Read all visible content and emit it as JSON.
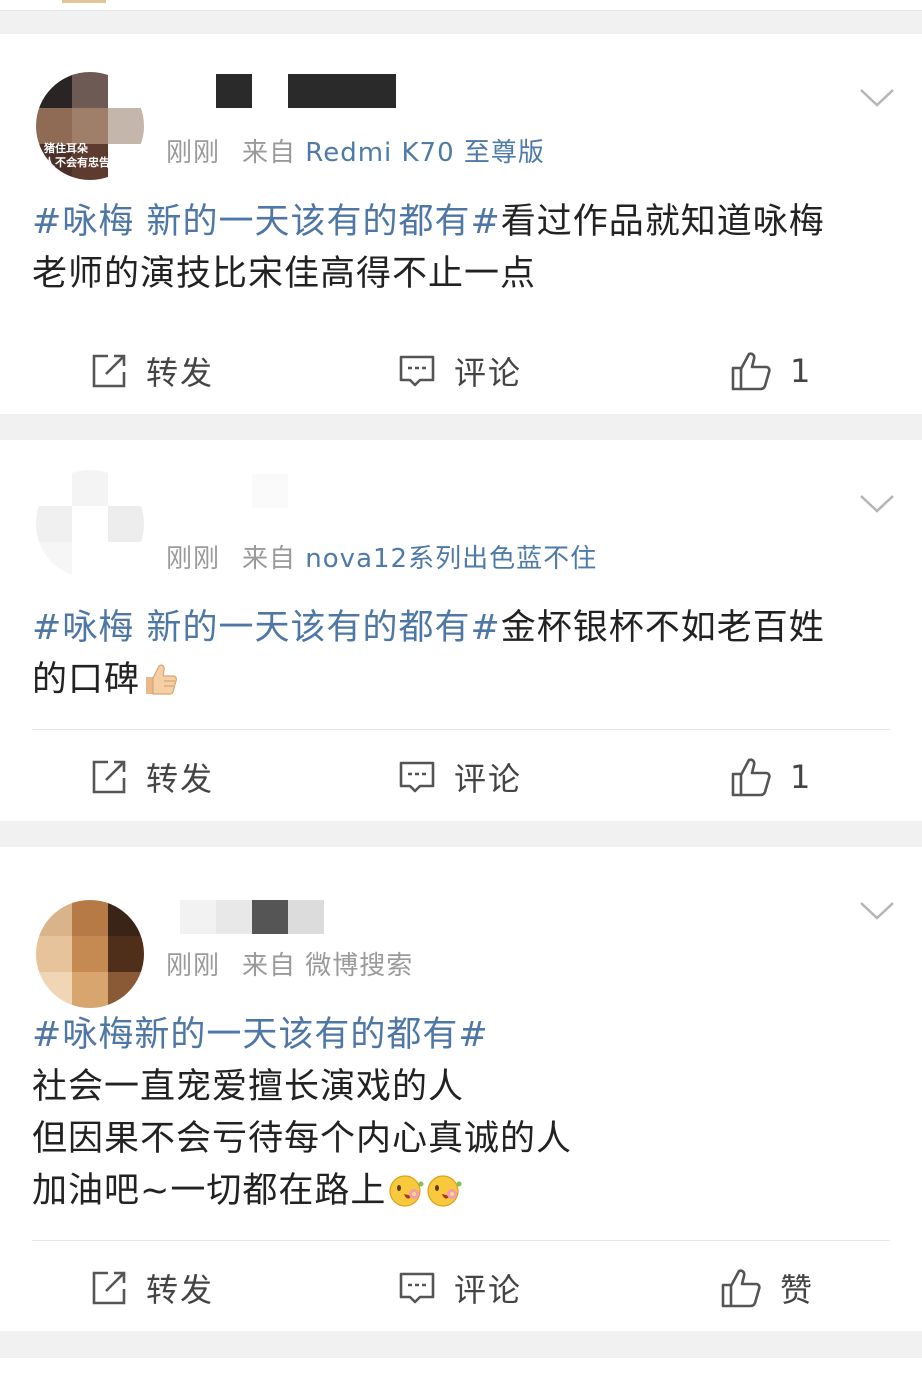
{
  "feed": {
    "posts": [
      {
        "time": "刚刚",
        "source_prefix": "来自",
        "source": "Redmi K70 至尊版",
        "avatar_caption": "猪住耳朵\n人不会有忠告",
        "text_tag": "#咏梅 新的一天该有的都有#",
        "text_lines": [
          "看过作品就知道咏梅",
          "老师的演技比宋佳高得不止一点"
        ],
        "repost_label": "转发",
        "comment_label": "评论",
        "like_label": "1"
      },
      {
        "time": "刚刚",
        "source_prefix": "来自",
        "source": "nova12系列出色蓝不住",
        "text_tag": "#咏梅 新的一天该有的都有#",
        "text_lines": [
          "金杯银杯不如老百姓",
          "的口碑"
        ],
        "emoji": "thumbs-up-emoji",
        "repost_label": "转发",
        "comment_label": "评论",
        "like_label": "1"
      },
      {
        "time": "刚刚",
        "source_prefix": "来自",
        "source": "微博搜索",
        "text_tag": "#咏梅新的一天该有的都有#",
        "text_lines": [
          "社会一直宠爱擅长演戏的人",
          "但因果不会亏待每个内心真诚的人",
          "加油吧~一切都在路上"
        ],
        "emoji": "flower-smile-emoji",
        "repost_label": "转发",
        "comment_label": "评论",
        "like_label": "赞"
      }
    ]
  },
  "colors": {
    "topic_blue": "#4e77a5",
    "meta_gray": "#9a9a9a",
    "text_dark": "#222222",
    "icon_gray": "#555555",
    "page_bg": "#f1f1f1"
  }
}
